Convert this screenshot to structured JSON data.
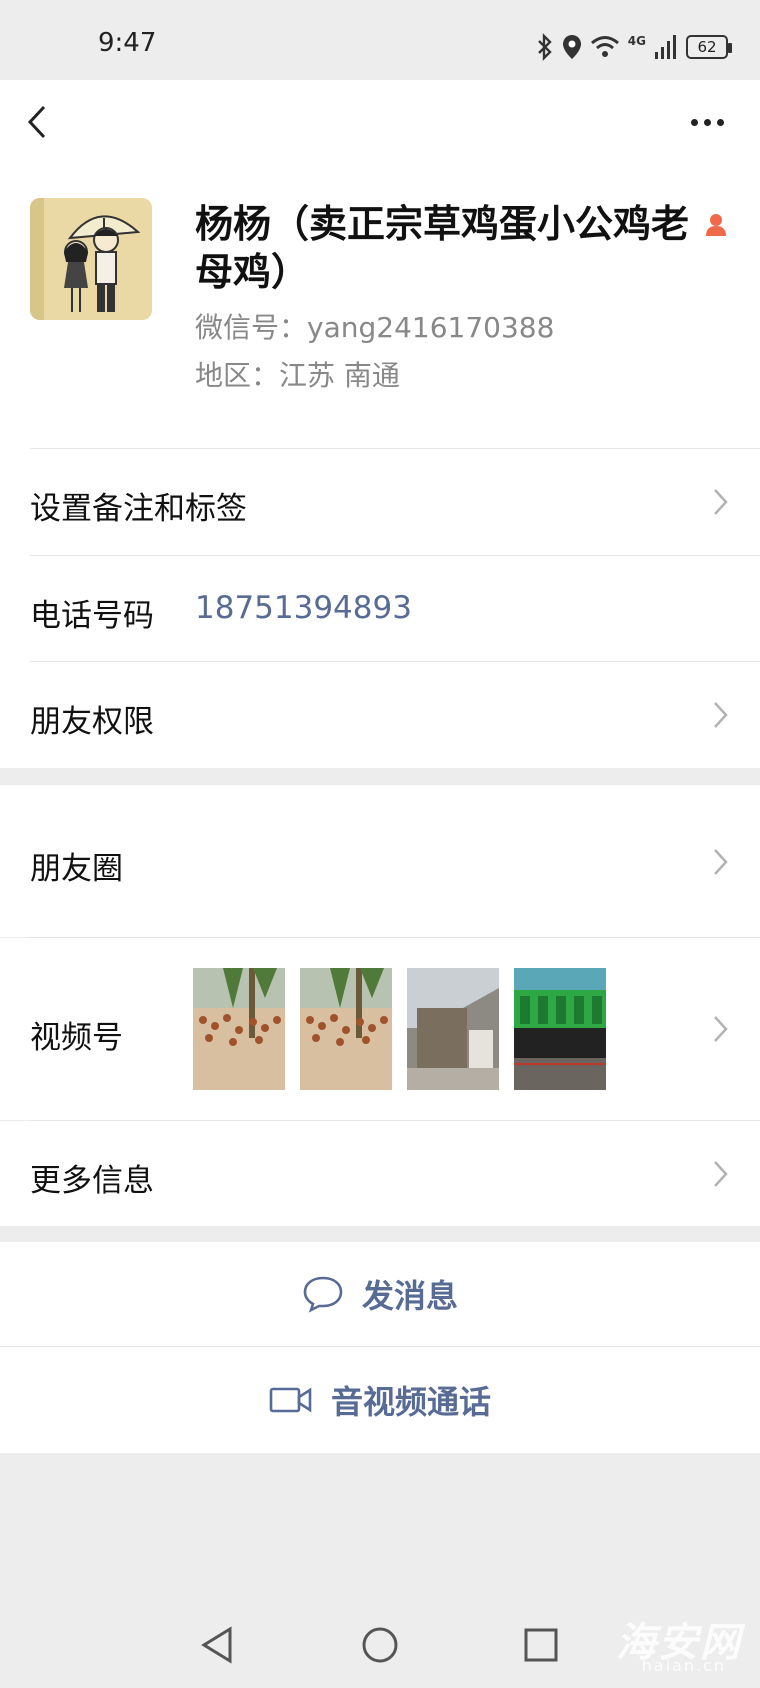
{
  "status_bar": {
    "time": "9:47",
    "network_label": "4G",
    "battery": "62"
  },
  "profile": {
    "display_name": "杨杨（卖正宗草鸡蛋小公鸡老母鸡）",
    "wechat_id": "微信号：yang2416170388",
    "region": "地区：江苏  南通"
  },
  "rows": {
    "remarks_label": "设置备注和标签",
    "phone_label": "电话号码",
    "phone_value": "18751394893",
    "permissions_label": "朋友权限",
    "moments_label": "朋友圈",
    "channels_label": "视频号",
    "more_info_label": "更多信息"
  },
  "actions": {
    "message_label": "发消息",
    "call_label": "音视频通话"
  },
  "watermark": {
    "main": "海安网",
    "sub": "haian.cn"
  },
  "colors": {
    "link": "#576b95",
    "background": "#ededed",
    "person_badge": "#f06a4a"
  },
  "icons": [
    "back-arrow-icon",
    "more-dots-icon",
    "person-icon",
    "chevron-right-icon",
    "chat-bubble-icon",
    "video-camera-icon",
    "nav-back-icon",
    "nav-home-icon",
    "nav-recents-icon"
  ]
}
